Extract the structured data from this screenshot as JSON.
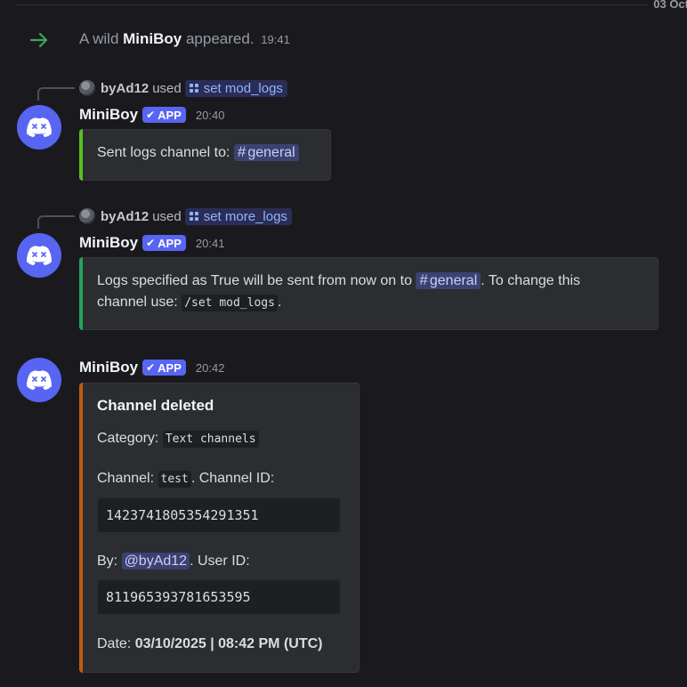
{
  "divider": {
    "date": "03 Oct"
  },
  "join": {
    "prefix": "A wild ",
    "name": "MiniBoy",
    "suffix": " appeared.",
    "time": "19:41"
  },
  "messages": [
    {
      "reply": {
        "user": "byAd12",
        "used": "used",
        "command": "set mod_logs"
      },
      "author": "MiniBoy",
      "badge": "APP",
      "time": "20:40",
      "embed": {
        "bar_color": "#57c11d",
        "text_before": "Sent logs channel to: ",
        "channel": "general"
      }
    },
    {
      "reply": {
        "user": "byAd12",
        "used": "used",
        "command": "set more_logs"
      },
      "author": "MiniBoy",
      "badge": "APP",
      "time": "20:41",
      "embed": {
        "bar_color": "#23a55a",
        "line1_before": "Logs specified as True will be sent from now on to ",
        "channel": "general",
        "line1_after": ". To change this",
        "line2_before": "channel use: ",
        "code": "/set mod_logs",
        "line2_after": "."
      }
    },
    {
      "author": "MiniBoy",
      "badge": "APP",
      "time": "20:42",
      "embed": {
        "bar_color": "#c35a0d",
        "title": "Channel deleted",
        "category_label": "Category: ",
        "category_value": "Text channels",
        "channel_label": "Channel: ",
        "channel_value": "test",
        "channel_id_label": ". Channel ID:",
        "channel_id": "1423741805354291351",
        "by_label": "By: ",
        "by_user": "@byAd12",
        "user_id_label": ". User ID:",
        "user_id": "811965393781653595",
        "date_label": "Date: ",
        "date_value": "03/10/2025 | 08:42 PM (UTC)"
      }
    }
  ],
  "icons": {
    "join": "arrow-right-icon",
    "avatar": "discord-logo-icon",
    "command": "slash-command-icon",
    "badge": "checkmark-icon",
    "channel": "hash-icon"
  },
  "colors": {
    "blurple": "#5865f2",
    "join_arrow": "#3ba55d",
    "background": "#1a1a1e"
  }
}
